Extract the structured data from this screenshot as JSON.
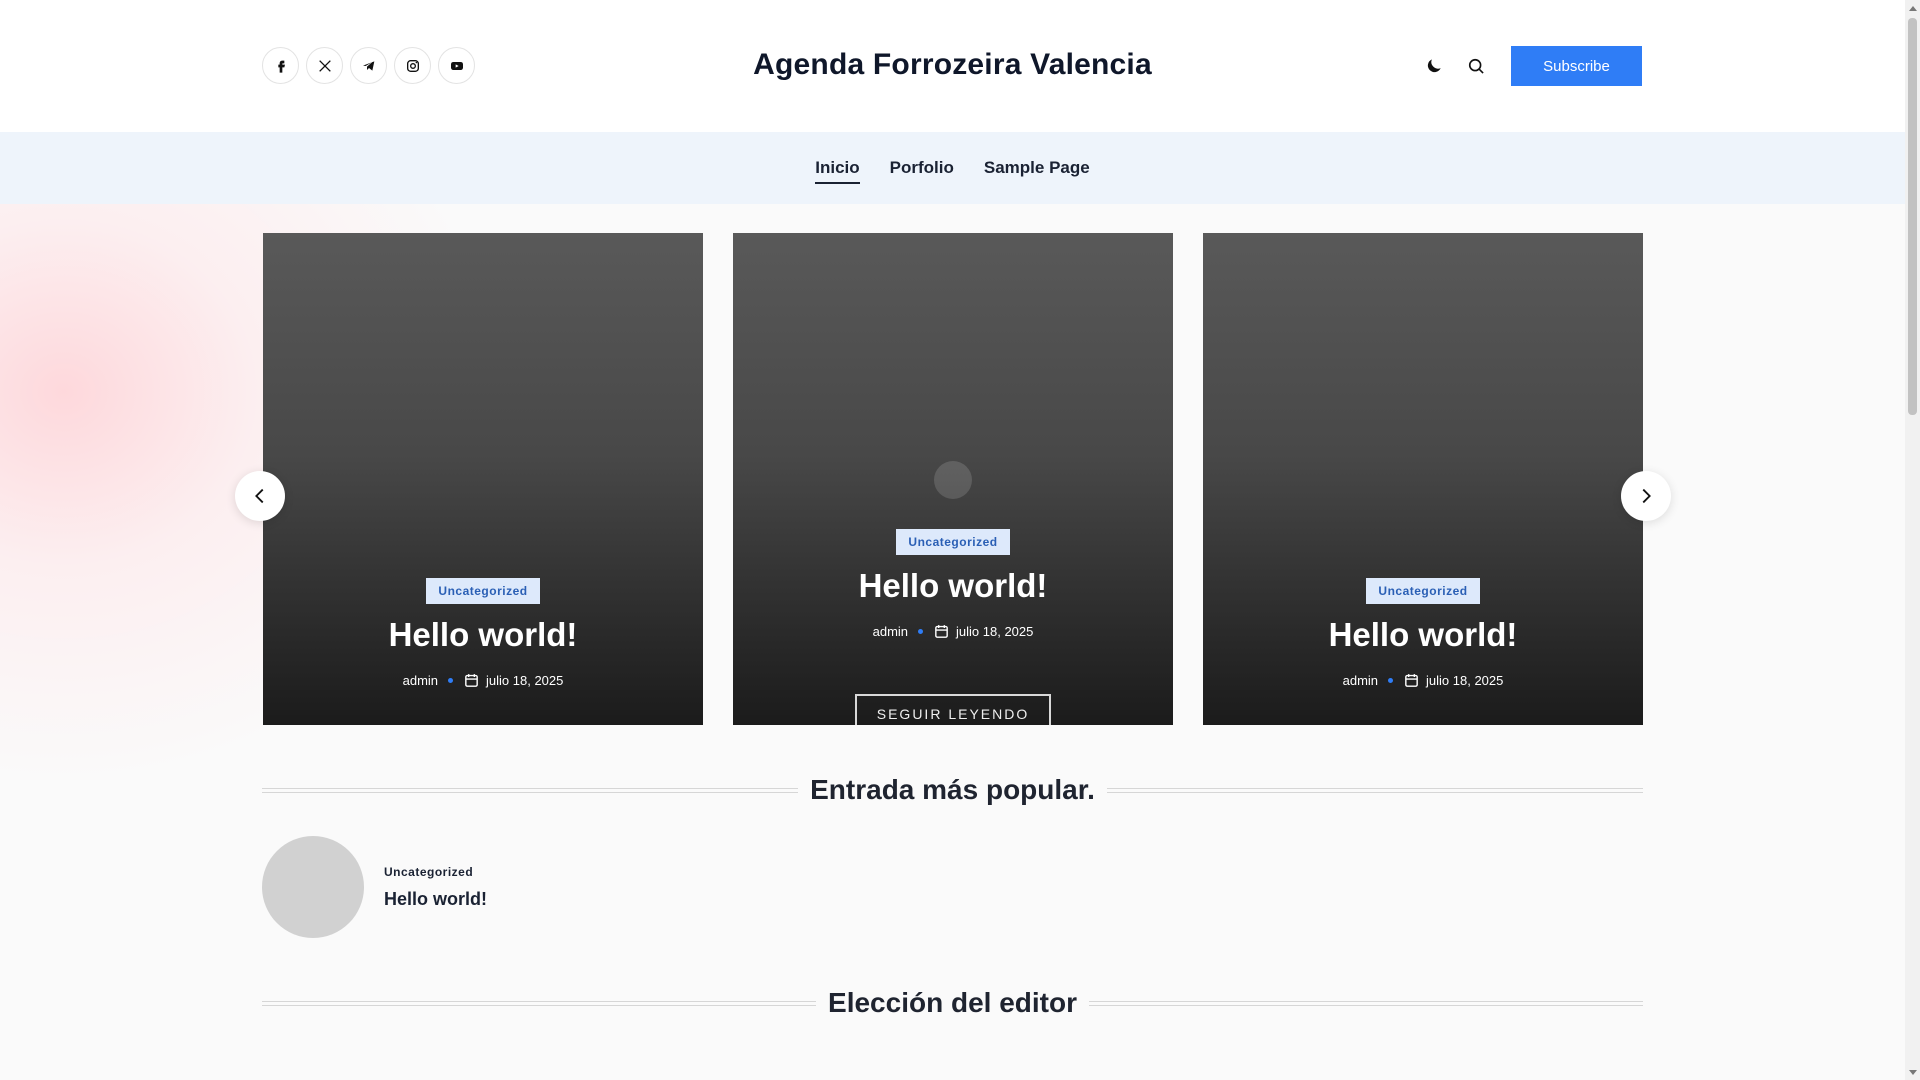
{
  "site": {
    "title": "Agenda Forrozeira Valencia"
  },
  "header": {
    "social": [
      {
        "name": "facebook-icon"
      },
      {
        "name": "x-twitter-icon"
      },
      {
        "name": "telegram-icon"
      },
      {
        "name": "instagram-icon"
      },
      {
        "name": "youtube-icon"
      }
    ],
    "theme_toggle_icon": "moon-icon",
    "search_icon": "search-icon",
    "subscribe_label": "Subscribe"
  },
  "nav": {
    "items": [
      {
        "label": "Inicio",
        "active": true
      },
      {
        "label": "Porfolio",
        "active": false
      },
      {
        "label": "Sample Page",
        "active": false
      }
    ]
  },
  "slider": {
    "cards": [
      {
        "category": "Uncategorized",
        "title": "Hello world!",
        "author": "admin",
        "date": "julio 18, 2025"
      },
      {
        "category": "Uncategorized",
        "title": "Hello world!",
        "author": "admin",
        "date": "julio 18, 2025",
        "read_more": "SEGUIR LEYENDO"
      },
      {
        "category": "Uncategorized",
        "title": "Hello world!",
        "author": "admin",
        "date": "julio 18, 2025"
      }
    ]
  },
  "popular": {
    "heading": "Entrada más popular.",
    "post": {
      "category": "Uncategorized",
      "title": "Hello world!"
    }
  },
  "editor": {
    "heading": "Elección del editor"
  },
  "colors": {
    "accent": "#2f7df6",
    "nav_bg": "#eef4fb",
    "badge_bg": "#dde9fb",
    "badge_text": "#2a5fb5"
  }
}
